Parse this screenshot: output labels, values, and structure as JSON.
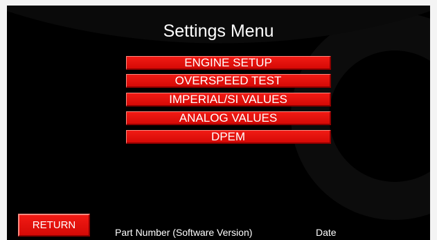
{
  "title": "Settings Menu",
  "menu": {
    "items": [
      {
        "label": "ENGINE SETUP"
      },
      {
        "label": "OVERSPEED TEST"
      },
      {
        "label": "IMPERIAL/SI VALUES"
      },
      {
        "label": "ANALOG VALUES"
      },
      {
        "label": "DPEM"
      }
    ]
  },
  "footer": {
    "return_label": "RETURN",
    "part_number": "Part Number (Software Version)",
    "date": "Date"
  },
  "colors": {
    "background": "#000000",
    "button": "#e8120c",
    "text": "#ffffff"
  }
}
